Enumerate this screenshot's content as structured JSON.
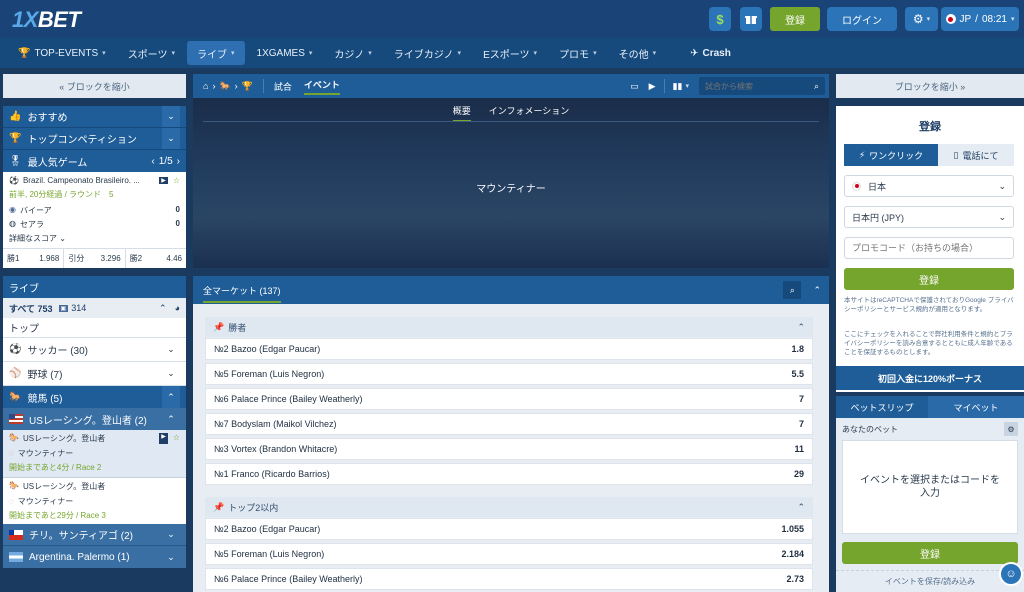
{
  "header": {
    "logo_x": "1X",
    "logo_bet": "BET",
    "register_label": "登録",
    "login_label": "ログイン",
    "locale": "JP",
    "time": "08:21"
  },
  "nav": [
    {
      "label": "TOP-EVENTS"
    },
    {
      "label": "スポーツ"
    },
    {
      "label": "ライブ"
    },
    {
      "label": "1XGAMES"
    },
    {
      "label": "カジノ"
    },
    {
      "label": "ライブカジノ"
    },
    {
      "label": "Eスポーツ"
    },
    {
      "label": "プロモ"
    },
    {
      "label": "その他"
    },
    {
      "label": "Crash"
    }
  ],
  "left": {
    "collapse_label": "« ブロックを縮小",
    "menu": [
      "おすすめ",
      "トップコンペティション"
    ],
    "popular_title": "最人気ゲーム",
    "popular_page": "1/5",
    "game": {
      "league": "Brazil. Campeonato Brasileiro. ...",
      "status": "前半, 20分経過 / ラウンド　5",
      "team1": "バイーア",
      "team2": "セアラ",
      "score1": "0",
      "score2": "0",
      "details": "詳細なスコア",
      "odds": [
        {
          "label": "勝1",
          "value": "1.968"
        },
        {
          "label": "引分",
          "value": "3.296"
        },
        {
          "label": "勝2",
          "value": "4.46"
        }
      ]
    },
    "live_title": "ライブ",
    "all_label": "すべて 753",
    "all_count": "314",
    "top_label": "トップ",
    "sports": [
      {
        "label": "サッカー (30)"
      },
      {
        "label": "野球 (7)"
      }
    ],
    "horse_label": "競馬 (5)",
    "us_label": "USレーシング。登山者 (2)",
    "races": [
      {
        "title": "USレーシング。登山者",
        "runner": "マウンティナー",
        "time": "開始まであと4分 / Race 2"
      },
      {
        "title": "USレーシング。登山者",
        "runner": "マウンティナー",
        "time": "開始まであと29分 / Race 3"
      }
    ],
    "chile_label": "チリ。サンティアゴ (2)",
    "arg_label": "Argentina. Palermo (1)"
  },
  "center": {
    "tab_match": "試合",
    "tab_event": "イベント",
    "search_placeholder": "試合から検索",
    "hero_tabs": [
      "概要",
      "インフォメーション"
    ],
    "event_name": "マウンティナー",
    "all_markets": "全マーケット (137)",
    "groups": [
      {
        "title": "勝者",
        "rows": [
          {
            "name": "№2 Bazoo (Edgar Paucar)",
            "odd": "1.8"
          },
          {
            "name": "№5 Foreman (Luis Negron)",
            "odd": "5.5"
          },
          {
            "name": "№6 Palace Prince (Bailey Weatherly)",
            "odd": "7"
          },
          {
            "name": "№7 Bodyslam (Maikol Vilchez)",
            "odd": "7"
          },
          {
            "name": "№3 Vortex (Brandon Whitacre)",
            "odd": "11"
          },
          {
            "name": "№1 Franco (Ricardo Barrios)",
            "odd": "29"
          }
        ]
      },
      {
        "title": "トップ2以内",
        "rows": [
          {
            "name": "№2 Bazoo (Edgar Paucar)",
            "odd": "1.055"
          },
          {
            "name": "№5 Foreman (Luis Negron)",
            "odd": "2.184"
          },
          {
            "name": "№6 Palace Prince (Bailey Weatherly)",
            "odd": "2.73"
          }
        ]
      }
    ]
  },
  "right": {
    "collapse_label": "ブロックを縮小 »",
    "reg_title": "登録",
    "one_click": "ワンクリック",
    "by_phone": "電話にて",
    "country": "日本",
    "currency": "日本円 (JPY)",
    "promo_placeholder": "プロモコード（お持ちの場合）",
    "register_btn": "登録",
    "recaptcha_text": "本サイトはreCAPTCHAで保護されておりGoogle プライバシーポリシーとサービス規約が適用となります。",
    "consent_text": "ここにチェックを入れることで弊社利用条件と規約とプライバシーポリシーを読み合意するとともに成人年齢であることを保証するものとします。",
    "bonus": "初回入金に120%ボーナス",
    "betslip_tab": "ベットスリップ",
    "mybets_tab": "マイベット",
    "your_bet": "あなたのベット",
    "empty_slip": "イベントを選択またはコードを入力",
    "slip_register": "登録",
    "save_load": "イベントを保存/読み込み"
  },
  "colors": {
    "accent_green": "#76a52e",
    "header_blue": "#1a4477",
    "active_blue": "#2d6fb0"
  }
}
